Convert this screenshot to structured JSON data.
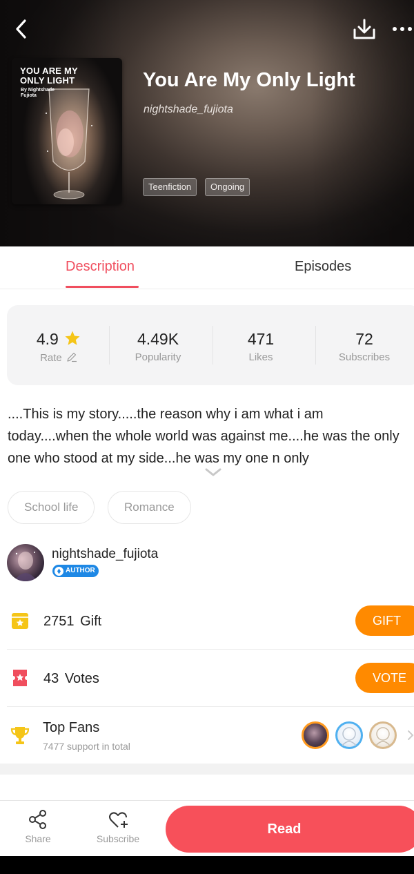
{
  "header": {
    "back_icon": "chevron-left-icon",
    "download_icon": "download-icon",
    "more_icon": "more-horizontal-icon"
  },
  "book": {
    "cover_title": "YOU ARE MY ONLY LIGHT",
    "cover_byline": "By Nightshade Fujiota",
    "title": "You Are My Only Light",
    "author": "nightshade_fujiota",
    "tags": [
      "Teenfiction",
      "Ongoing"
    ]
  },
  "tabs": [
    {
      "label": "Description",
      "active": true
    },
    {
      "label": "Episodes",
      "active": false
    }
  ],
  "stats": [
    {
      "value": "4.9",
      "label": "Rate",
      "value_icon": "star-icon",
      "label_icon": "pencil-icon"
    },
    {
      "value": "4.49K",
      "label": "Popularity"
    },
    {
      "value": "471",
      "label": "Likes"
    },
    {
      "value": "72",
      "label": "Subscribes"
    }
  ],
  "description": {
    "text": "....This is my story.....the reason why i am what i am today....when the whole world was against me....he was the only one who stood at my side...he was my one n only",
    "expand_icon": "chevron-down-icon"
  },
  "genres": [
    "School life",
    "Romance"
  ],
  "author_block": {
    "name": "nightshade_fujiota",
    "badge": "AUTHOR"
  },
  "gift": {
    "count": "2751",
    "label": "Gift",
    "button": "GIFT"
  },
  "votes": {
    "count": "43",
    "label": "Votes",
    "button": "VOTE"
  },
  "top_fans": {
    "title": "Top Fans",
    "subtitle": "7477 support in total"
  },
  "bottom_bar": {
    "share_label": "Share",
    "subscribe_label": "Subscribe",
    "read_label": "Read"
  },
  "colors": {
    "accent_red": "#f04e5e",
    "orange": "#ff8a00",
    "gold": "#f5c518",
    "author_blue": "#1e88e5"
  }
}
